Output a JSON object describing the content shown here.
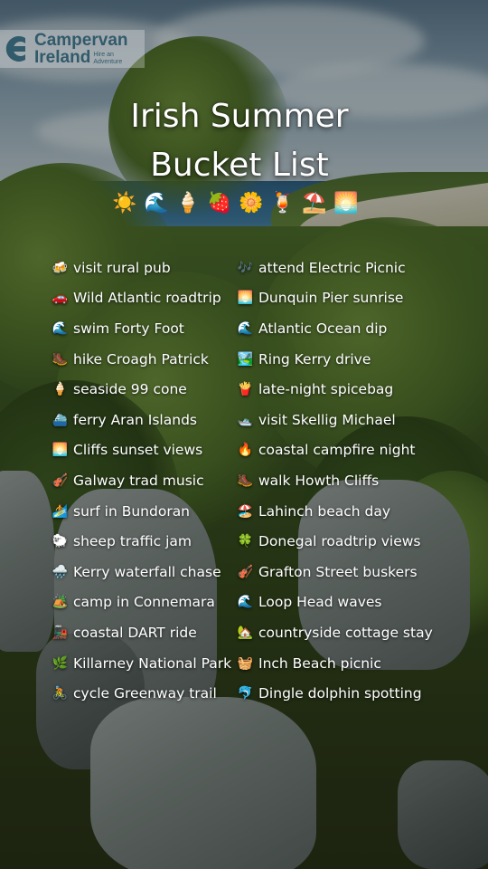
{
  "brand": {
    "line1": "Campervan",
    "line2": "Ireland",
    "tagline": "Hire an Adventure",
    "color": "#315a6b"
  },
  "title": {
    "line1": "Irish Summer",
    "line2": "Bucket List"
  },
  "emoji_row": [
    "☀️",
    "🌊",
    "🍦",
    "🍓",
    "🌼",
    "🍹",
    "⛱️",
    "🌅"
  ],
  "left_list": [
    {
      "icon": "🍻",
      "label": "visit rural pub"
    },
    {
      "icon": "🚗",
      "label": "Wild Atlantic roadtrip"
    },
    {
      "icon": "🌊",
      "label": "swim Forty Foot"
    },
    {
      "icon": "🥾",
      "label": "hike Croagh Patrick"
    },
    {
      "icon": "🍦",
      "label": "seaside 99 cone"
    },
    {
      "icon": "⛴️",
      "label": "ferry Aran Islands"
    },
    {
      "icon": "🌅",
      "label": "Cliffs sunset views"
    },
    {
      "icon": "🎻",
      "label": "Galway trad music"
    },
    {
      "icon": "🏄",
      "label": "surf in Bundoran"
    },
    {
      "icon": "🐑",
      "label": "sheep traffic jam"
    },
    {
      "icon": "🌧️",
      "label": "Kerry waterfall chase"
    },
    {
      "icon": "🏕️",
      "label": "camp in Connemara"
    },
    {
      "icon": "🚂",
      "label": "coastal DART ride"
    },
    {
      "icon": "🌿",
      "label": "Killarney National Park"
    },
    {
      "icon": "🚴",
      "label": "cycle Greenway trail"
    }
  ],
  "right_list": [
    {
      "icon": "🎶",
      "label": "attend Electric Picnic"
    },
    {
      "icon": "🌅",
      "label": "Dunquin Pier sunrise"
    },
    {
      "icon": "🌊",
      "label": "Atlantic Ocean dip"
    },
    {
      "icon": "🏞️",
      "label": "Ring Kerry drive"
    },
    {
      "icon": "🍟",
      "label": "late-night spicebag"
    },
    {
      "icon": "🛥️",
      "label": "visit Skellig Michael"
    },
    {
      "icon": "🔥",
      "label": "coastal campfire night"
    },
    {
      "icon": "🥾",
      "label": "walk Howth Cliffs"
    },
    {
      "icon": "🏖️",
      "label": "Lahinch beach day"
    },
    {
      "icon": "🍀",
      "label": "Donegal roadtrip views"
    },
    {
      "icon": "🎻",
      "label": "Grafton Street buskers"
    },
    {
      "icon": "🌊",
      "label": "Loop Head waves"
    },
    {
      "icon": "🏡",
      "label": "countryside cottage stay"
    },
    {
      "icon": "🧺",
      "label": "Inch Beach picnic"
    },
    {
      "icon": "🐬",
      "label": "Dingle dolphin spotting"
    }
  ]
}
